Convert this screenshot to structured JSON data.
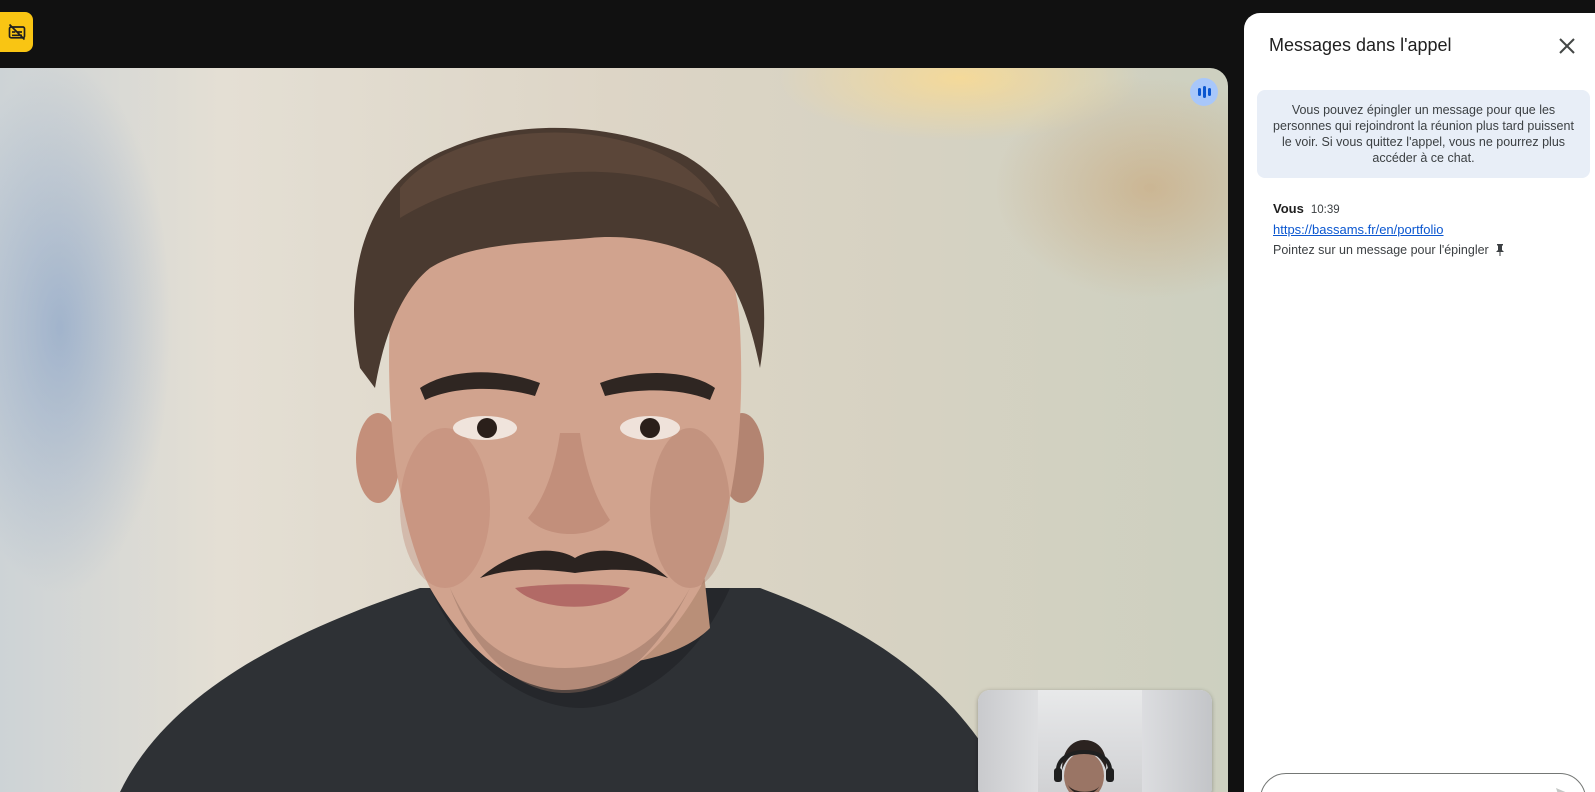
{
  "badge": {
    "icon": "captions-off-icon",
    "color": "#f9c513"
  },
  "main_video": {
    "speaking_icon": "speaking-indicator-icon"
  },
  "self_view": {
    "label": ""
  },
  "panel": {
    "title": "Messages dans l'appel",
    "close_icon": "close-icon",
    "info_text": "Vous pouvez épingler un message pour que les personnes qui rejoindront la réunion plus tard puissent le voir. Si vous quittez l'appel, vous ne pourrez plus accéder à ce chat.",
    "messages": [
      {
        "sender": "Vous",
        "time": "10:39",
        "link": "https://bassams.fr/en/portfolio",
        "hint": "Pointez sur un message pour l'épingler"
      }
    ],
    "composer": {
      "placeholder": "",
      "send_icon": "send-icon"
    }
  },
  "colors": {
    "accent": "#0b57d0",
    "panel_bg": "#ffffff",
    "info_bg": "#e8eef7",
    "app_bg": "#111111"
  }
}
